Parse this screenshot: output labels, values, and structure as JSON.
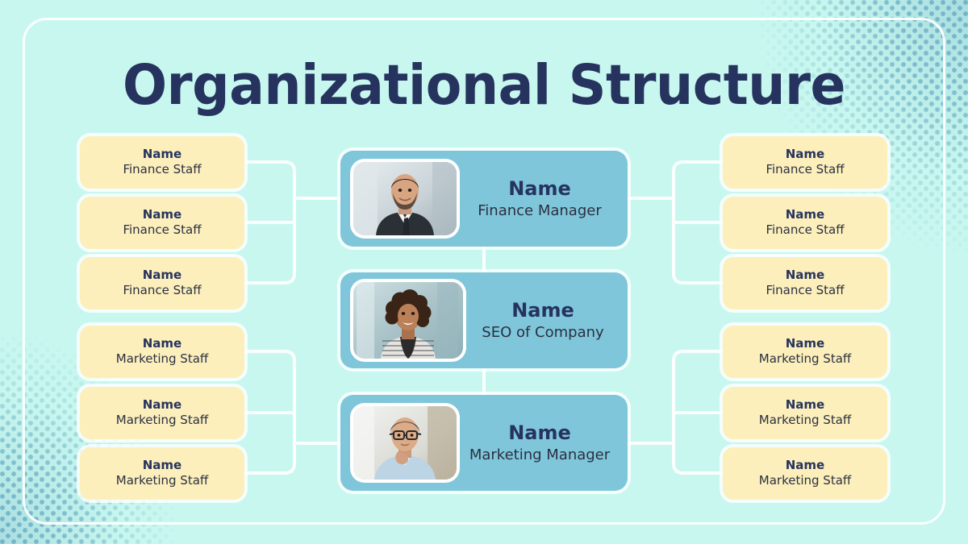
{
  "slide": {
    "title": "Organizational Structure",
    "background_color": "#C7F7EF",
    "frame_color": "#FFFFFF",
    "accent_colors": {
      "title_navy": "#26335E",
      "manager_card_blue": "#7FC6DA",
      "staff_card_yellow": "#FCEFBC",
      "connector_white": "#FFFFFF",
      "halftone_dot": "#6FB2C6"
    }
  },
  "managers": [
    {
      "name": "Name",
      "role": "Finance Manager",
      "photo": "portrait-man-suit"
    },
    {
      "name": "Name",
      "role": "SEO of Company",
      "photo": "portrait-woman-curly-hair"
    },
    {
      "name": "Name",
      "role": "Marketing Manager",
      "photo": "portrait-man-glasses"
    }
  ],
  "left_staff": [
    {
      "name": "Name",
      "role": "Finance Staff"
    },
    {
      "name": "Name",
      "role": "Finance Staff"
    },
    {
      "name": "Name",
      "role": "Finance Staff"
    },
    {
      "name": "Name",
      "role": "Marketing Staff"
    },
    {
      "name": "Name",
      "role": "Marketing Staff"
    },
    {
      "name": "Name",
      "role": "Marketing Staff"
    }
  ],
  "right_staff": [
    {
      "name": "Name",
      "role": "Finance Staff"
    },
    {
      "name": "Name",
      "role": "Finance Staff"
    },
    {
      "name": "Name",
      "role": "Finance Staff"
    },
    {
      "name": "Name",
      "role": "Marketing Staff"
    },
    {
      "name": "Name",
      "role": "Marketing Staff"
    },
    {
      "name": "Name",
      "role": "Marketing Staff"
    }
  ]
}
